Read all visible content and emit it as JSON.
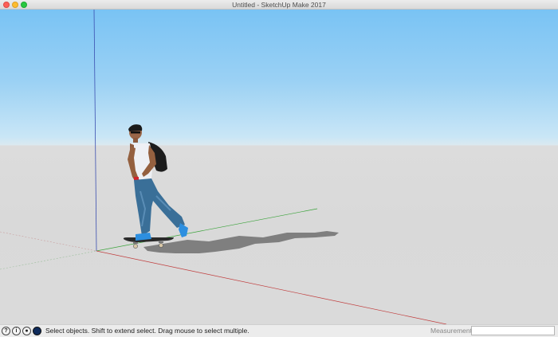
{
  "window": {
    "title": "Untitled - SketchUp Make 2017"
  },
  "scene": {
    "sky_color": "#79c3f4",
    "ground_color": "#d9d9d9",
    "axes": {
      "blue": "#3b4fb0",
      "green": "#3aa33a",
      "red": "#c03b3b"
    },
    "model": "skateboarder-figure"
  },
  "statusbar": {
    "icons": [
      "geo-location-icon",
      "credits-icon",
      "user-icon",
      "instructor-icon"
    ],
    "hint": "Select objects. Shift to extend select. Drag mouse to select multiple.",
    "measurements_label": "Measurements",
    "measurements_value": ""
  }
}
